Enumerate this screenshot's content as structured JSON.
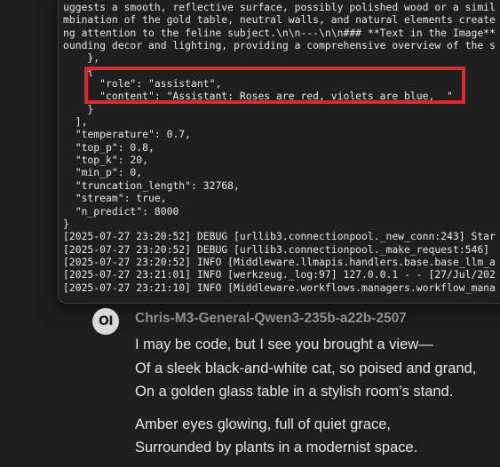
{
  "terminal": {
    "lines": [
      "uggests a smooth, reflective surface, possibly polished wood or a simil",
      "mbination of the gold table, neutral walls, and natural elements create",
      "ng attention to the feline subject.\\n\\n---\\n\\n### **Text in the Image**",
      "ounding decor and lighting, providing a comprehensive overview of the s",
      "    },",
      "    {",
      "      \"role\": \"assistant\",",
      "      \"content\": \"Assistant: Roses are red, violets are blue,  \"",
      "    }",
      "  ],",
      "  \"temperature\": 0.7,",
      "  \"top_p\": 0.8,",
      "  \"top_k\": 20,",
      "  \"min_p\": 0,",
      "  \"truncation_length\": 32768,",
      "  \"stream\": true,",
      "  \"n_predict\": 8000",
      "}",
      "[2025-07-27 23:20:52] DEBUG [urllib3.connectionpool._new_conn:243] Star",
      "[2025-07-27 23:20:52] DEBUG [urllib3.connectionpool._make_request:546]",
      "[2025-07-27 23:20:52] INFO [Middleware.llmapis.handlers.base.base_llm_a",
      "[2025-07-27 23:21:01] INFO [werkzeug._log:97] 127.0.0.1 - - [27/Jul/202",
      "[2025-07-27 23:21:10] INFO [Middleware.workflows.managers.workflow_mana"
    ],
    "highlight_color": "#e3262d"
  },
  "message": {
    "avatar_text": "OI",
    "model_name": "Chris-M3-General-Qwen3-235b-a22b-2507",
    "stanzas": [
      [
        "I may be code, but I see you brought a view—",
        "Of a sleek black-and-white cat, so poised and grand,",
        "On a golden glass table in a stylish room’s stand."
      ],
      [
        "Amber eyes glowing, full of quiet grace,",
        "Surrounded by plants in a modernist space."
      ]
    ]
  }
}
